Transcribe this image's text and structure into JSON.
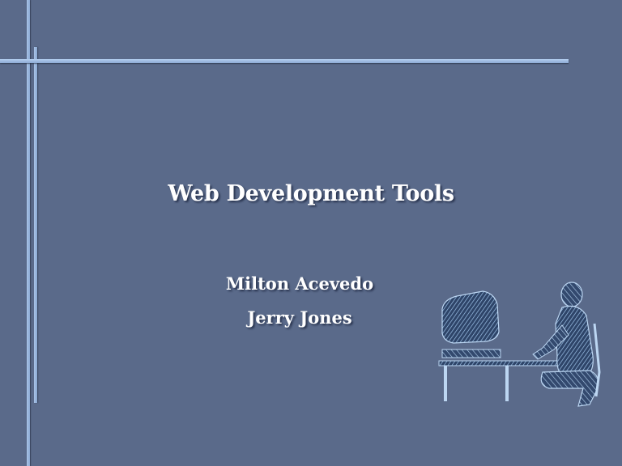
{
  "slide": {
    "title": "Web Development Tools",
    "authors": [
      "Milton Acevedo",
      "Jerry Jones"
    ]
  },
  "decor": {
    "illustration_icon": "person-at-computer-icon",
    "frame_color": "#a9c3e6",
    "background_color": "#5a6a8a"
  }
}
